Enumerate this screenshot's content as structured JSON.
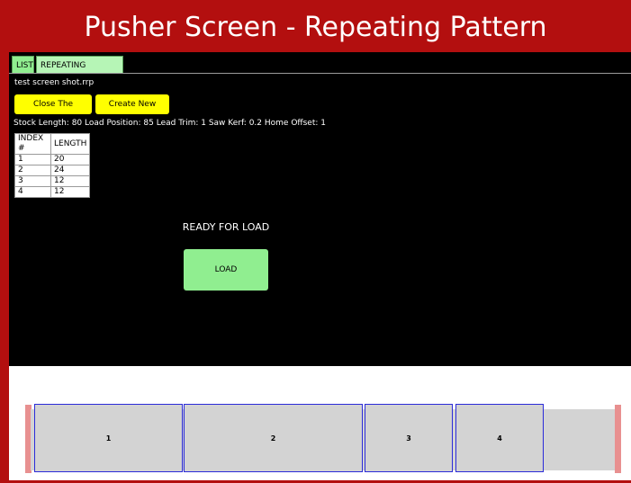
{
  "title": "Pusher Screen - Repeating Pattern",
  "tabs": [
    {
      "label": "LIST"
    },
    {
      "label": "REPEATING PATTERN"
    }
  ],
  "file_name": "test screen shot.rrp",
  "buttons": {
    "close_file": "Close The File(*.rrp)",
    "create_new": "Create New (*.rrp)",
    "load": "LOAD"
  },
  "params_text": "Stock Length:  80  Load Position:  85  Lead Trim:  1  Saw Kerf:  0.2  Home Offset: 1",
  "table": {
    "headers": [
      "INDEX #",
      "LENGTH"
    ],
    "rows": [
      [
        "1",
        "20"
      ],
      [
        "2",
        "24"
      ],
      [
        "3",
        "12"
      ],
      [
        "4",
        "12"
      ]
    ]
  },
  "status": "READY FOR LOAD",
  "pieces": [
    "1",
    "2",
    "3",
    "4"
  ],
  "colors": {
    "brand_red": "#b30f0f",
    "tab_green": "#90ee90",
    "button_yellow": "#ffff00",
    "piece_border": "#2b2bd9",
    "stock_gray": "#d3d3d3",
    "end_marker": "#e89090"
  }
}
